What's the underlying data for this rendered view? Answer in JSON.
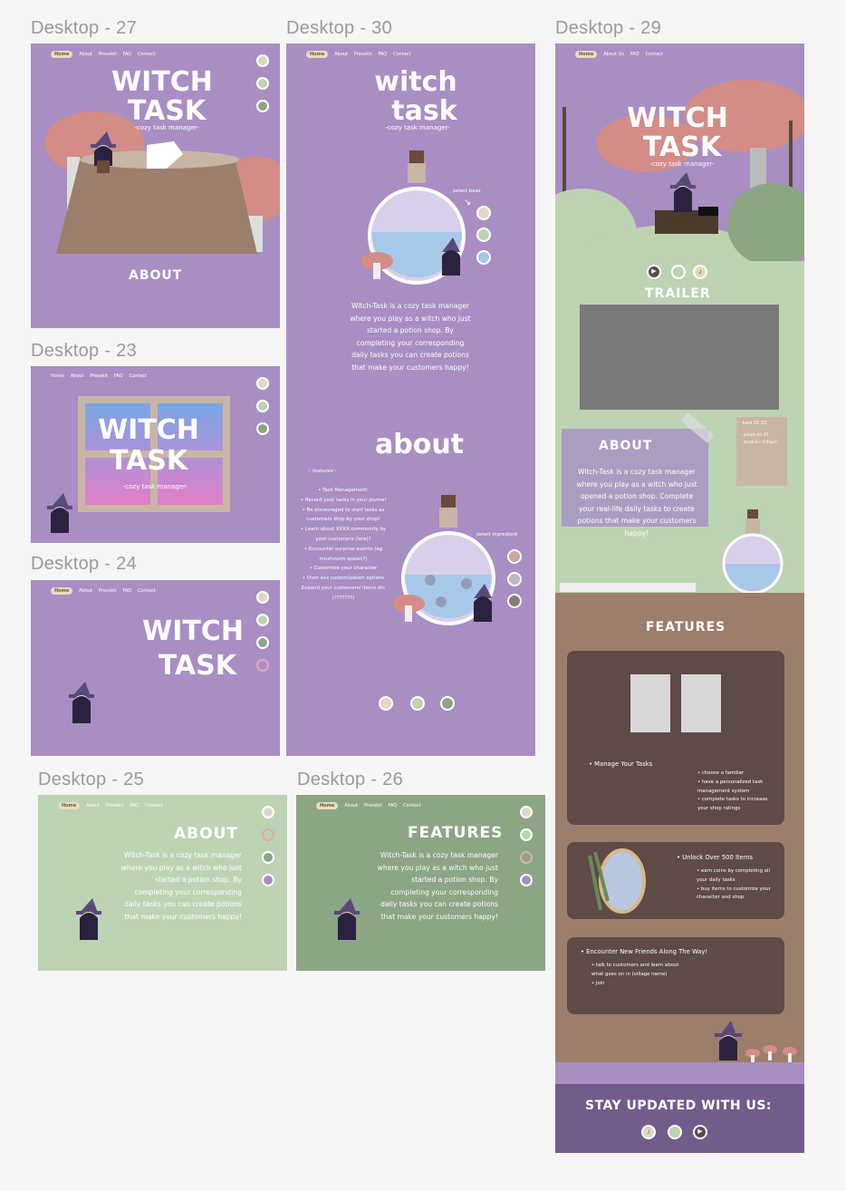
{
  "frames": {
    "f27": {
      "label": "Desktop - 27",
      "nav": [
        "Home",
        "About",
        "Presskit",
        "FAQ",
        "Contact"
      ],
      "title1": "WITCH",
      "title2": "TASK",
      "subtitle": "-cozy task manager-",
      "section": "ABOUT"
    },
    "f23": {
      "label": "Desktop - 23",
      "nav": [
        "Home",
        "About",
        "Presskit",
        "FAQ",
        "Contact"
      ],
      "title1": "WITCH",
      "title2": "TASK",
      "subtitle": "-cozy task manager-"
    },
    "f24": {
      "label": "Desktop - 24",
      "nav": [
        "Home",
        "About",
        "Presskit",
        "FAQ",
        "Contact"
      ],
      "title1": "WITCH",
      "title2": "TASK"
    },
    "f25": {
      "label": "Desktop - 25",
      "nav": [
        "Home",
        "About",
        "Presskit",
        "FAQ",
        "Contact"
      ],
      "section": "ABOUT",
      "lines": [
        "Witch-Task is a cozy task manager",
        "where you play as a witch who just",
        "started a potion shop. By",
        "completing your corresponding",
        "daily tasks you can create potions",
        "that make your customers happy!"
      ]
    },
    "f26": {
      "label": "Desktop - 26",
      "nav": [
        "Home",
        "About",
        "Presskit",
        "FAQ",
        "Contact"
      ],
      "section": "FEATURES",
      "lines": [
        "Witch-Task is a cozy task manager",
        "where you play as a witch who just",
        "started a potion shop. By",
        "completing your corresponding",
        "daily tasks you can create potions",
        "that make your customers happy!"
      ]
    },
    "f30": {
      "label": "Desktop - 30",
      "nav": [
        "Home",
        "About",
        "Presskit",
        "FAQ",
        "Contact"
      ],
      "title1": "witch",
      "title2": "task",
      "subtitle": "-cozy task manager-",
      "select_base": "select base",
      "select_ingredient": "select ingredient",
      "lines": [
        "Witch-Task is a cozy task manager",
        "where you play as a witch who just",
        "started a potion shop. By",
        "completing your corresponding",
        "daily tasks you can create potions",
        "that make your customers happy!"
      ],
      "about": "about",
      "features_head": "-'.features'-.",
      "features": [
        "•  Task Management:",
        "•  Record your tasks in your journal",
        "•  Be encouraged to start tasks as",
        "customers drop by your shop!",
        "•  Learn about XXXX community by",
        "your customers (lore)?",
        "•  Encounter surprise events (eg",
        "mushroom queen?)",
        "•  Customize your character",
        "•  Over xxx customization options",
        "Expand your customers/ items etc",
        "(???????)"
      ]
    },
    "f29": {
      "label": "Desktop - 29",
      "nav": [
        "Home",
        "About Us",
        "FAQ",
        "Contact"
      ],
      "title1": "WITCH",
      "title2": "TASK",
      "subtitle": "-cozy task manager-",
      "trailer": "TRAILER",
      "about": "ABOUT",
      "note_title": "task 01.12",
      "note_lines": [
        "- potato for 45",
        "- deadline: 5:00pm"
      ],
      "about_lines": [
        "Witch-Task is a cozy task manager",
        "where you play as a witch who just",
        "opened a potion shop. Complete",
        "your real-life daily tasks to create",
        "potions that make your customers",
        "happy!"
      ],
      "features_title": "FEATURES",
      "card1_main": "•  Manage Your Tasks",
      "card1_sub": [
        "•  choose a familiar",
        "•  have a personalized task",
        "management system",
        "•  complete tasks to increase",
        "your shop ratings"
      ],
      "card2_main": "•  Unlock Over 500 Items",
      "card2_sub": [
        "•  earn coins by completing all",
        "your daily tasks",
        "•  buy items to customize your",
        "character and shop"
      ],
      "card3_main": "•  Encounter New Friends Along The Way!",
      "card3_sub": [
        "•  talk to customers and learn about",
        "what goes on in (village name)",
        "•  join"
      ],
      "stay": "STAY UPDATED WITH US:"
    }
  },
  "colors": {
    "purple": "#a88ec2",
    "sage": "#bcd3b4",
    "sage_dark": "#8ca585",
    "brown": "#9c7e6d",
    "card": "#5e4a47",
    "footer": "#725c8c"
  }
}
